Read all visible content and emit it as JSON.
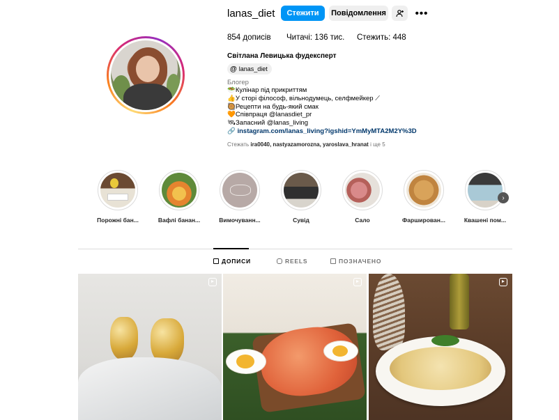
{
  "profile": {
    "username": "lanas_diet",
    "follow_label": "Стежити",
    "message_label": "Повідомлення",
    "add_user_icon": "add-user-icon",
    "more_icon": "•••",
    "stats": {
      "posts": "854 дописів",
      "followers": "Читачі: 136 тис.",
      "following": "Стежить: 448"
    },
    "full_name": "Світлана Левицька фудексперт",
    "threads_handle": "lanas_diet",
    "category": "Блогер",
    "bio_lines": [
      "🥗Кулінар під прикриттям",
      "👍У сторі філософ, вільнодумець, селфмейкер ⟋",
      "🥘Рецепти на будь-який смак",
      "🧡Співпраця @lanasdiet_pr",
      "🛰Запасний @lanas_living"
    ],
    "link": "instagram.com/lanas_living?igshid=YmMyMTA2M2Y%3D",
    "followed_by_prefix": "Стежать",
    "followed_by_names": "ira0040, nastyazamorozna, yaroslava_hranat",
    "followed_by_suffix": "і ще 5"
  },
  "highlights": [
    {
      "label": "Порожні бан..."
    },
    {
      "label": "Вафлі банан..."
    },
    {
      "label": "Вимочуванн..."
    },
    {
      "label": "Сувід"
    },
    {
      "label": "Сало"
    },
    {
      "label": "Фарширован..."
    },
    {
      "label": "Квашені пом..."
    }
  ],
  "highlights_next": "›",
  "tabs": {
    "posts": "ДОПИСИ",
    "reels": "REELS",
    "tagged": "ПОЗНАЧЕНО"
  },
  "colors": {
    "accent": "#0095f6",
    "secondary_bg": "#efefef",
    "muted_text": "#737373",
    "link": "#00376b"
  }
}
